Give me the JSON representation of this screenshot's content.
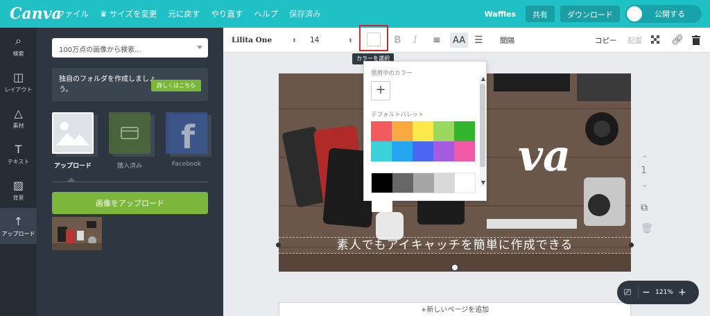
{
  "topbar": {
    "logo": "Canva",
    "menu": [
      "ファイル",
      "サイズを変更",
      "元に戻す",
      "やり直す",
      "ヘルプ"
    ],
    "status": "保存済み",
    "team": "Waffles",
    "share": "共有",
    "download": "ダウンロード",
    "publish": "公開する"
  },
  "rail": [
    {
      "label": "検索",
      "icon": "search-icon"
    },
    {
      "label": "レイアウト",
      "icon": "layout-icon"
    },
    {
      "label": "素材",
      "icon": "elements-icon"
    },
    {
      "label": "テキスト",
      "icon": "text-icon"
    },
    {
      "label": "背景",
      "icon": "background-icon"
    },
    {
      "label": "アップロード",
      "icon": "upload-icon"
    }
  ],
  "panel": {
    "search_placeholder": "100万点の画像から検索...",
    "folder_text": "独自のフォルダを作成しましょう。",
    "folder_button": "詳しくはこちら",
    "tabs": [
      "アップロード",
      "購入済み",
      "Facebook"
    ],
    "upload_button": "画像をアップロード"
  },
  "toolbar": {
    "font": "Lilita One",
    "size": "14",
    "spacing": "間隔",
    "copy": "コピー",
    "arrange": "配置"
  },
  "tooltip": "カラーを選択",
  "popover": {
    "used_colors": "使用中のカラー",
    "default_palette": "デフォルトパレット",
    "palette": [
      "#f15b5b",
      "#f7a83e",
      "#fbe94a",
      "#99d85c",
      "#33b52d",
      "#3cd2dc",
      "#26a5f0",
      "#4a66f2",
      "#a35be0",
      "#f25aa8"
    ],
    "grays": [
      "#000000",
      "#666666",
      "#a6a6a6",
      "#d9d9d9",
      "#ffffff"
    ]
  },
  "canvas": {
    "big_text": "va",
    "caption": "素人でもアイキャッチを簡単に作成できる"
  },
  "page_number": "1",
  "add_page": "+新しいページを追加",
  "zoom": "121%"
}
